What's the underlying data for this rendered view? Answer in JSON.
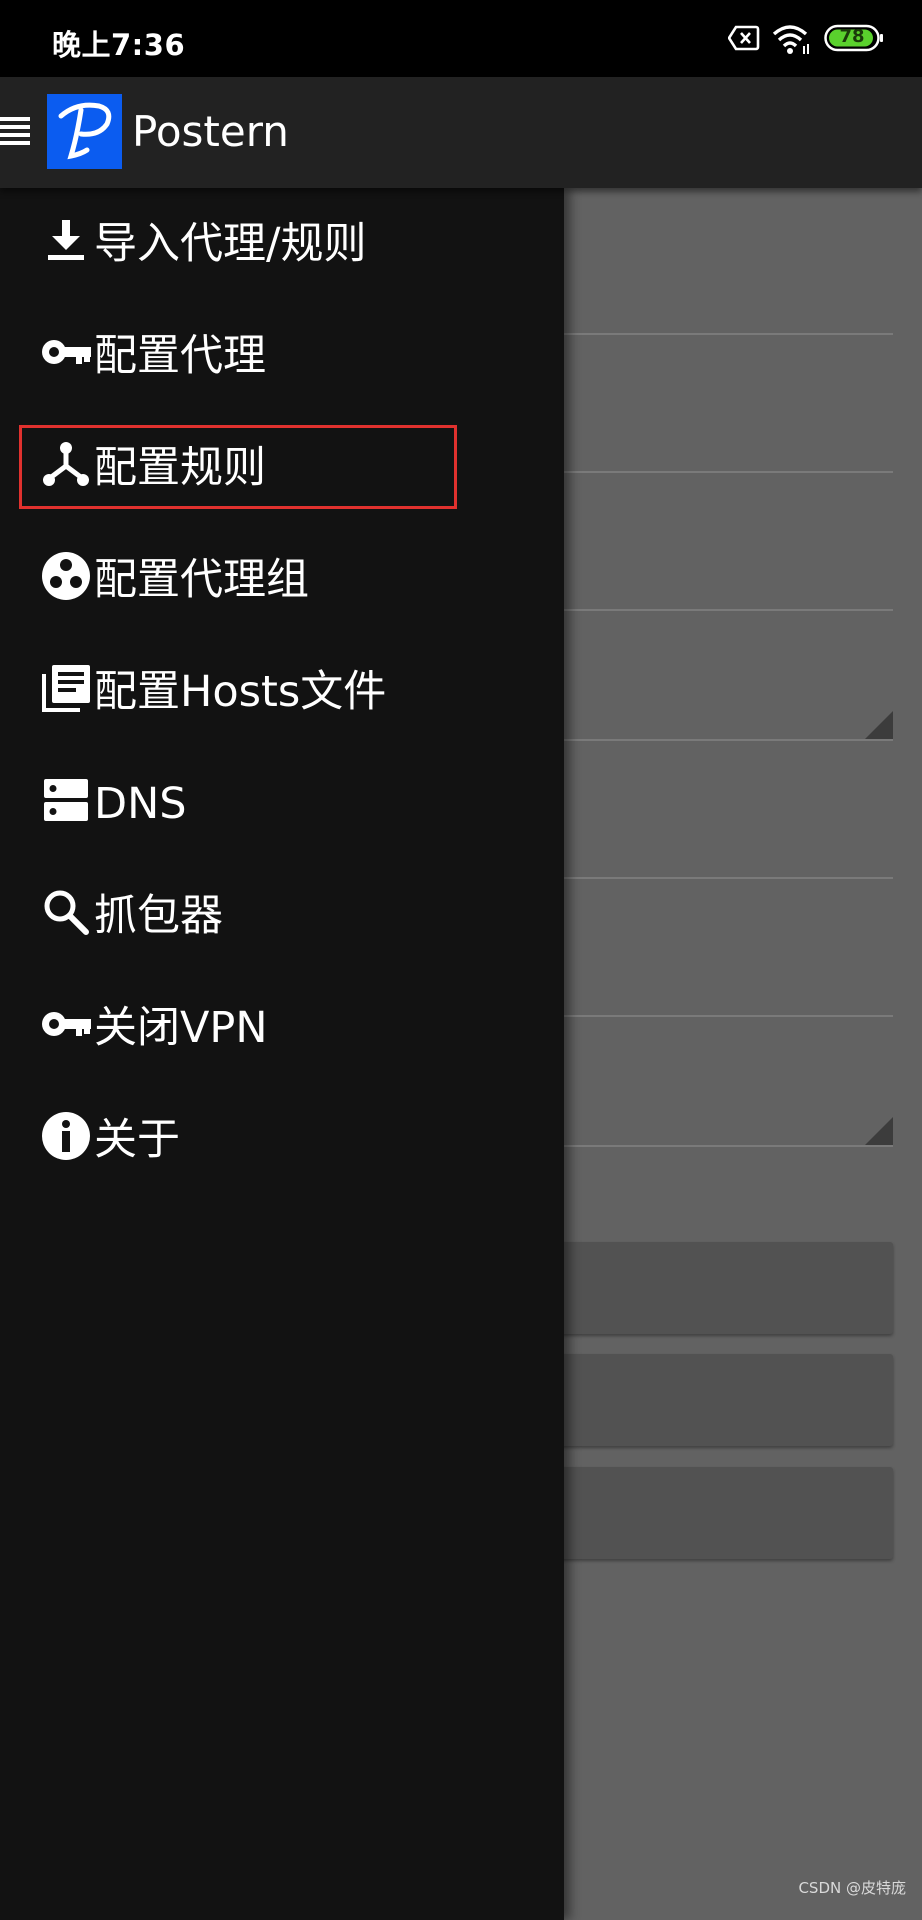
{
  "status_bar": {
    "time": "晚上7:36",
    "battery_level": "78",
    "icons": [
      "sim-off-icon",
      "wifi-icon",
      "battery-icon"
    ]
  },
  "app_bar": {
    "title": "Postern",
    "logo_letter": "P",
    "logo_color": "#0b5cf0"
  },
  "drawer": {
    "items": [
      {
        "label": "导入代理/规则",
        "icon": "download-icon"
      },
      {
        "label": "配置代理",
        "icon": "key-icon"
      },
      {
        "label": "配置规则",
        "icon": "rules-fork-icon",
        "highlighted": true
      },
      {
        "label": "配置代理组",
        "icon": "proxy-group-icon"
      },
      {
        "label": "配置Hosts文件",
        "icon": "hosts-file-icon"
      },
      {
        "label": "DNS",
        "icon": "dns-server-icon"
      },
      {
        "label": "抓包器",
        "icon": "search-icon"
      },
      {
        "label": "关闭VPN",
        "icon": "key-icon"
      },
      {
        "label": "关于",
        "icon": "info-icon"
      }
    ],
    "highlight_color": "#e0312e"
  },
  "watermark": "CSDN @皮特庞"
}
